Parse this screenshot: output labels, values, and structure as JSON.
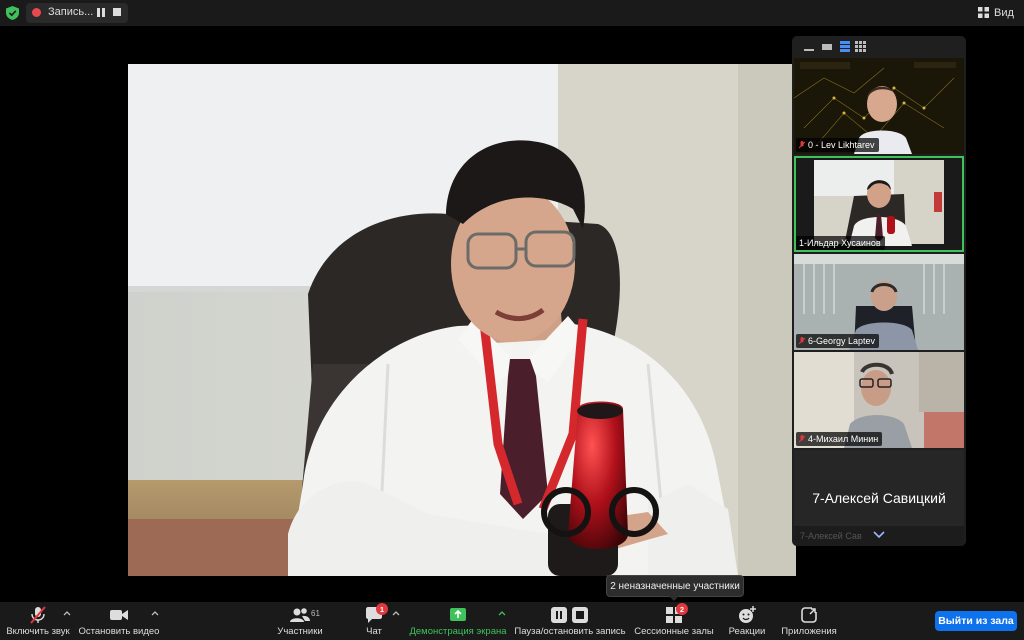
{
  "top_bar": {
    "recording_label": "Запись...",
    "view_label": "Вид"
  },
  "gallery": {
    "tiles": [
      {
        "name": "0 - Lev Likhtarev"
      },
      {
        "name": "1-Ильдар Хусаинов"
      },
      {
        "name": "6-Georgy Laptev"
      },
      {
        "name": "4-Михаил Минин"
      },
      {
        "display_name": "7-Алексей Савицкий"
      }
    ],
    "partial_tile_name": "7-Алексей Сав"
  },
  "tooltip": "2 неназначенные участники",
  "toolbar": {
    "audio_label": "Включить звук",
    "video_label": "Остановить видео",
    "participants_label": "Участники",
    "participants_count": "61",
    "chat_label": "Чат",
    "chat_badge": "1",
    "share_label": "Демонстрация экрана",
    "record_label": "Пауза/остановить запись",
    "breakout_label": "Сессионные залы",
    "breakout_badge": "2",
    "reactions_label": "Реакции",
    "apps_label": "Приложения",
    "leave_label": "Выйти из зала"
  },
  "colors": {
    "accent_green": "#3fc15b",
    "leave_blue": "#0e72ed",
    "badge_red": "#e0383e"
  }
}
